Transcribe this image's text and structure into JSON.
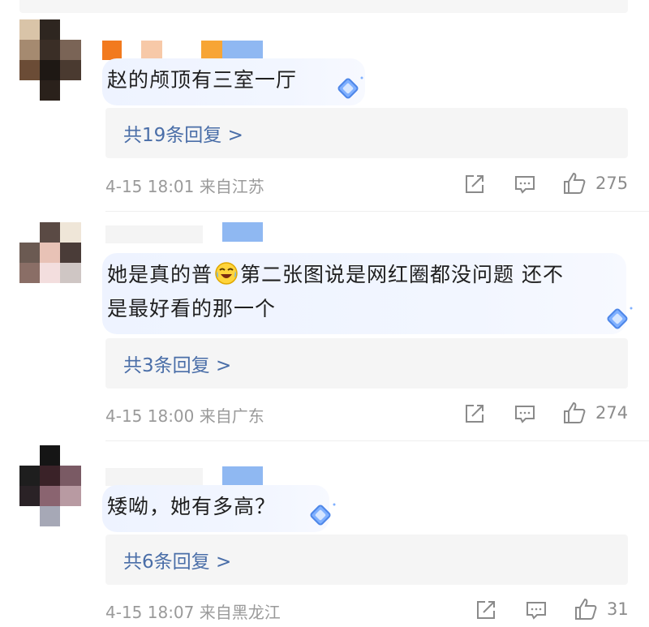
{
  "comments": [
    {
      "text": "赵的颅顶有三室一厅",
      "replies_label": "共19条回复 >",
      "time": "4-15 18:01",
      "location": "来自江苏",
      "likes": "275"
    },
    {
      "text_part1": "她是真的普",
      "emoji_icon": "laughing-crying-emoji",
      "text_part2": "第二张图说是网红圈都没问题 还不",
      "text_line2": "是最好看的那一个",
      "replies_label": "共3条回复 >",
      "time": "4-15 18:00",
      "location": "来自广东",
      "likes": "274"
    },
    {
      "text": "矮呦，她有多高？",
      "replies_label": "共6条回复 >",
      "time": "4-15 18:07",
      "location": "来自黑龙江",
      "likes": "31"
    }
  ],
  "colors": {
    "reply_link": "#4a6ea8",
    "meta_text": "#9a9a9a",
    "bubble_bg": "#eef3ff",
    "replies_bg": "#f5f5f5"
  },
  "icons": [
    "share-icon",
    "comment-icon",
    "thumbs-up-icon",
    "diamond-badge-icon"
  ]
}
